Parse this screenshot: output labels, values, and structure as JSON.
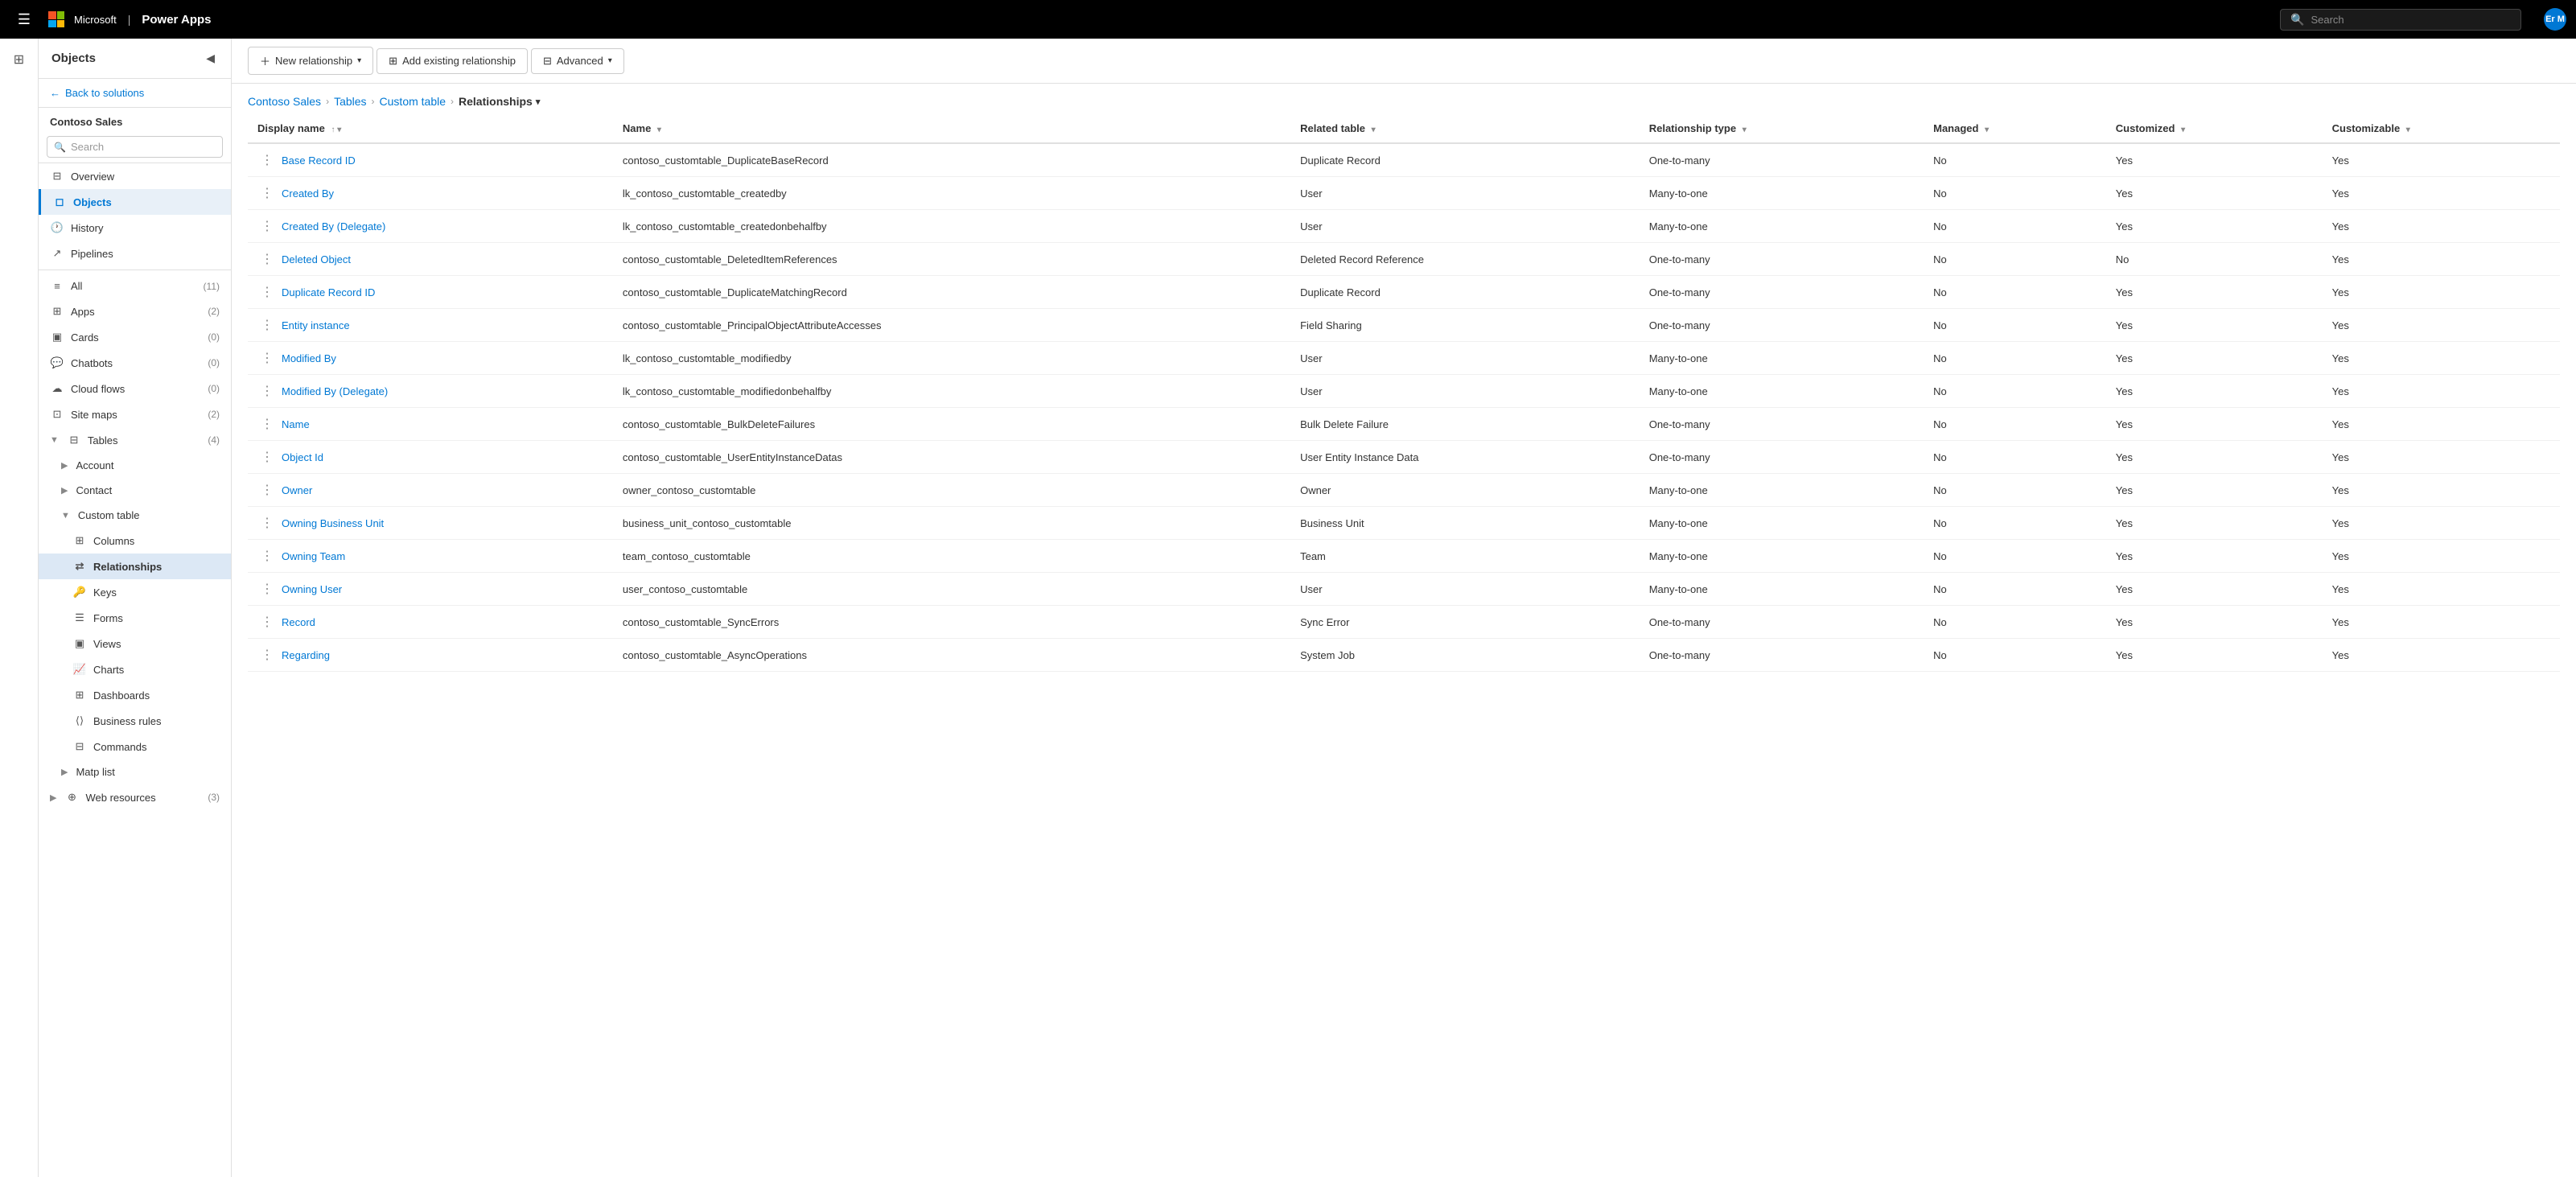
{
  "topnav": {
    "app_name": "Power Apps",
    "search_placeholder": "Search",
    "user_initials": "Er M"
  },
  "left_nav": {
    "hamburger_label": "Menu"
  },
  "sidebar": {
    "title": "Objects",
    "search_placeholder": "Search",
    "back_label": "Back to solutions",
    "section_title": "Contoso Sales",
    "items": [
      {
        "id": "overview",
        "label": "Overview",
        "icon": "⊞",
        "count": ""
      },
      {
        "id": "objects",
        "label": "Objects",
        "icon": "◻",
        "count": "",
        "active": true
      },
      {
        "id": "history",
        "label": "History",
        "icon": "🕐",
        "count": ""
      },
      {
        "id": "pipelines",
        "label": "Pipelines",
        "icon": "↗",
        "count": ""
      }
    ],
    "objects_items": [
      {
        "id": "all",
        "label": "All",
        "count": "(11)",
        "indent": 0
      },
      {
        "id": "apps",
        "label": "Apps",
        "count": "(2)",
        "indent": 0
      },
      {
        "id": "cards",
        "label": "Cards",
        "count": "(0)",
        "indent": 0
      },
      {
        "id": "chatbots",
        "label": "Chatbots",
        "count": "(0)",
        "indent": 0
      },
      {
        "id": "cloud-flows",
        "label": "Cloud flows",
        "count": "(0)",
        "indent": 0
      },
      {
        "id": "site-maps",
        "label": "Site maps",
        "count": "(2)",
        "indent": 0
      },
      {
        "id": "tables",
        "label": "Tables",
        "count": "(4)",
        "indent": 0,
        "expanded": true
      },
      {
        "id": "account",
        "label": "Account",
        "count": "",
        "indent": 1
      },
      {
        "id": "contact",
        "label": "Contact",
        "count": "",
        "indent": 1
      },
      {
        "id": "custom-table",
        "label": "Custom table",
        "count": "",
        "indent": 1,
        "expanded": true
      },
      {
        "id": "columns",
        "label": "Columns",
        "count": "",
        "indent": 2
      },
      {
        "id": "relationships",
        "label": "Relationships",
        "count": "",
        "indent": 2,
        "active": true
      },
      {
        "id": "keys",
        "label": "Keys",
        "count": "",
        "indent": 2
      },
      {
        "id": "forms",
        "label": "Forms",
        "count": "",
        "indent": 2
      },
      {
        "id": "views",
        "label": "Views",
        "count": "",
        "indent": 2
      },
      {
        "id": "charts",
        "label": "Charts",
        "count": "",
        "indent": 2
      },
      {
        "id": "dashboards",
        "label": "Dashboards",
        "count": "",
        "indent": 2
      },
      {
        "id": "business-rules",
        "label": "Business rules",
        "count": "",
        "indent": 2
      },
      {
        "id": "commands",
        "label": "Commands",
        "count": "",
        "indent": 2
      },
      {
        "id": "matp-list",
        "label": "Matp list",
        "count": "",
        "indent": 1
      },
      {
        "id": "web-resources",
        "label": "Web resources",
        "count": "(3)",
        "indent": 0
      }
    ]
  },
  "toolbar": {
    "new_relationship": "New relationship",
    "add_existing": "Add existing relationship",
    "advanced": "Advanced"
  },
  "breadcrumb": {
    "items": [
      "Contoso Sales",
      "Tables",
      "Custom table"
    ],
    "current": "Relationships"
  },
  "table": {
    "columns": [
      {
        "id": "display-name",
        "label": "Display name",
        "sortable": true
      },
      {
        "id": "name",
        "label": "Name",
        "sortable": true
      },
      {
        "id": "related-table",
        "label": "Related table",
        "sortable": true
      },
      {
        "id": "relationship-type",
        "label": "Relationship type",
        "sortable": true
      },
      {
        "id": "managed",
        "label": "Managed",
        "sortable": true
      },
      {
        "id": "customized",
        "label": "Customized",
        "sortable": true
      },
      {
        "id": "customizable",
        "label": "Customizable",
        "sortable": true
      }
    ],
    "rows": [
      {
        "display_name": "Base Record ID",
        "name": "contoso_customtable_DuplicateBaseRecord",
        "related_table": "Duplicate Record",
        "relationship_type": "One-to-many",
        "managed": "No",
        "customized": "Yes",
        "customizable": "Yes"
      },
      {
        "display_name": "Created By",
        "name": "lk_contoso_customtable_createdby",
        "related_table": "User",
        "relationship_type": "Many-to-one",
        "managed": "No",
        "customized": "Yes",
        "customizable": "Yes"
      },
      {
        "display_name": "Created By (Delegate)",
        "name": "lk_contoso_customtable_createdonbehalfby",
        "related_table": "User",
        "relationship_type": "Many-to-one",
        "managed": "No",
        "customized": "Yes",
        "customizable": "Yes"
      },
      {
        "display_name": "Deleted Object",
        "name": "contoso_customtable_DeletedItemReferences",
        "related_table": "Deleted Record Reference",
        "relationship_type": "One-to-many",
        "managed": "No",
        "customized": "No",
        "customizable": "Yes"
      },
      {
        "display_name": "Duplicate Record ID",
        "name": "contoso_customtable_DuplicateMatchingRecord",
        "related_table": "Duplicate Record",
        "relationship_type": "One-to-many",
        "managed": "No",
        "customized": "Yes",
        "customizable": "Yes"
      },
      {
        "display_name": "Entity instance",
        "name": "contoso_customtable_PrincipalObjectAttributeAccesses",
        "related_table": "Field Sharing",
        "relationship_type": "One-to-many",
        "managed": "No",
        "customized": "Yes",
        "customizable": "Yes"
      },
      {
        "display_name": "Modified By",
        "name": "lk_contoso_customtable_modifiedby",
        "related_table": "User",
        "relationship_type": "Many-to-one",
        "managed": "No",
        "customized": "Yes",
        "customizable": "Yes"
      },
      {
        "display_name": "Modified By (Delegate)",
        "name": "lk_contoso_customtable_modifiedonbehalfby",
        "related_table": "User",
        "relationship_type": "Many-to-one",
        "managed": "No",
        "customized": "Yes",
        "customizable": "Yes"
      },
      {
        "display_name": "Name",
        "name": "contoso_customtable_BulkDeleteFailures",
        "related_table": "Bulk Delete Failure",
        "relationship_type": "One-to-many",
        "managed": "No",
        "customized": "Yes",
        "customizable": "Yes"
      },
      {
        "display_name": "Object Id",
        "name": "contoso_customtable_UserEntityInstanceDatas",
        "related_table": "User Entity Instance Data",
        "relationship_type": "One-to-many",
        "managed": "No",
        "customized": "Yes",
        "customizable": "Yes"
      },
      {
        "display_name": "Owner",
        "name": "owner_contoso_customtable",
        "related_table": "Owner",
        "relationship_type": "Many-to-one",
        "managed": "No",
        "customized": "Yes",
        "customizable": "Yes"
      },
      {
        "display_name": "Owning Business Unit",
        "name": "business_unit_contoso_customtable",
        "related_table": "Business Unit",
        "relationship_type": "Many-to-one",
        "managed": "No",
        "customized": "Yes",
        "customizable": "Yes"
      },
      {
        "display_name": "Owning Team",
        "name": "team_contoso_customtable",
        "related_table": "Team",
        "relationship_type": "Many-to-one",
        "managed": "No",
        "customized": "Yes",
        "customizable": "Yes"
      },
      {
        "display_name": "Owning User",
        "name": "user_contoso_customtable",
        "related_table": "User",
        "relationship_type": "Many-to-one",
        "managed": "No",
        "customized": "Yes",
        "customizable": "Yes"
      },
      {
        "display_name": "Record",
        "name": "contoso_customtable_SyncErrors",
        "related_table": "Sync Error",
        "relationship_type": "One-to-many",
        "managed": "No",
        "customized": "Yes",
        "customizable": "Yes"
      },
      {
        "display_name": "Regarding",
        "name": "contoso_customtable_AsyncOperations",
        "related_table": "System Job",
        "relationship_type": "One-to-many",
        "managed": "No",
        "customized": "Yes",
        "customizable": "Yes"
      }
    ]
  }
}
